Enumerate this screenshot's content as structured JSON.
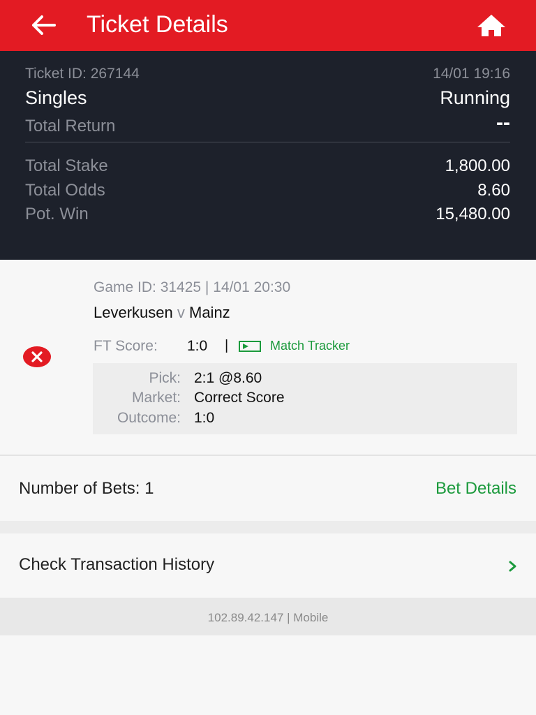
{
  "header": {
    "title": "Ticket Details",
    "back_icon": "arrow-left-icon",
    "home_icon": "home-icon",
    "bg_color": "#e31b23"
  },
  "summary": {
    "ticket_id": "Ticket ID: 267144",
    "datetime": "14/01 19:16",
    "bet_type": "Singles",
    "status": "Running",
    "total_return_label": "Total Return",
    "total_return_value": "--",
    "total_stake_label": "Total Stake",
    "total_stake_value": "1,800.00",
    "total_odds_label": "Total Odds",
    "total_odds_value": "8.60",
    "pot_win_label": "Pot. Win",
    "pot_win_value": "15,480.00"
  },
  "game": {
    "info": "Game ID: 31425 | 14/01 20:30",
    "home_team": "Leverkusen",
    "versus": "v",
    "away_team": "Mainz",
    "ft_score_label": "FT Score:",
    "ft_score_value": "1:0",
    "separator": "|",
    "match_tracker_label": "Match Tracker",
    "status_icon": "lost-x-icon",
    "pick_label": "Pick:",
    "pick_value": "2:1 @8.60",
    "market_label": "Market:",
    "market_value": "Correct Score",
    "outcome_label": "Outcome:",
    "outcome_value": "1:0"
  },
  "bets": {
    "number_label": "Number of Bets: 1",
    "details_link": "Bet Details"
  },
  "history": {
    "label": "Check Transaction History",
    "chevron_icon": "chevron-right-icon"
  },
  "footer": {
    "text": "102.89.42.147 | Mobile"
  },
  "colors": {
    "accent_red": "#e31b23",
    "dark_panel": "#1d212b",
    "green": "#1b9a3c"
  }
}
